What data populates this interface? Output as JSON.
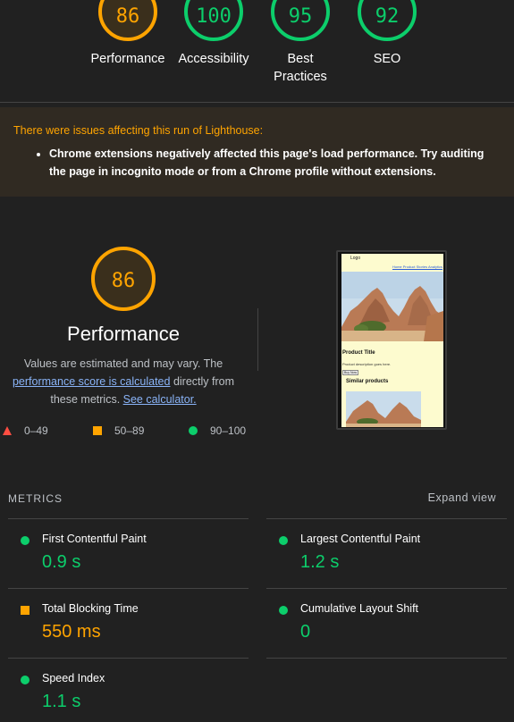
{
  "categories": [
    {
      "score": "86",
      "label": "Performance",
      "rating": "average"
    },
    {
      "score": "100",
      "label": "Accessibility",
      "rating": "pass"
    },
    {
      "score": "95",
      "label": "Best Practices",
      "rating": "pass"
    },
    {
      "score": "92",
      "label": "SEO",
      "rating": "pass"
    }
  ],
  "warning": {
    "title": "There were issues affecting this run of Lighthouse:",
    "item": "Chrome extensions negatively affected this page's load performance. Try auditing the page in incognito mode or from a Chrome profile without extensions."
  },
  "performance": {
    "score": "86",
    "title": "Performance",
    "desc_prefix": "Values are estimated and may vary. The ",
    "link_score": "performance score is calculated",
    "desc_middle": " directly from these metrics. ",
    "link_calc": "See calculator."
  },
  "legend": {
    "fail": "0–49",
    "average": "50–89",
    "pass": "90–100"
  },
  "thumbnail": {
    "logo": "Logo",
    "nav": "Home Product Stories Analytics",
    "product_title": "Product Title",
    "product_desc": "Product description goes here.",
    "button": "Buy Now",
    "similar": "Similar products"
  },
  "metrics": {
    "heading": "METRICS",
    "expand": "Expand view",
    "fcp": {
      "name": "First Contentful Paint",
      "value": "0.9 s"
    },
    "lcp": {
      "name": "Largest Contentful Paint",
      "value": "1.2 s"
    },
    "tbt": {
      "name": "Total Blocking Time",
      "value": "550 ms"
    },
    "cls": {
      "name": "Cumulative Layout Shift",
      "value": "0"
    },
    "si": {
      "name": "Speed Index",
      "value": "1.1 s"
    }
  },
  "colors": {
    "pass": "#0cce6b",
    "average": "#ffa400",
    "fail": "#ff4e42",
    "background": "#212121",
    "link": "#8ab4f8"
  }
}
